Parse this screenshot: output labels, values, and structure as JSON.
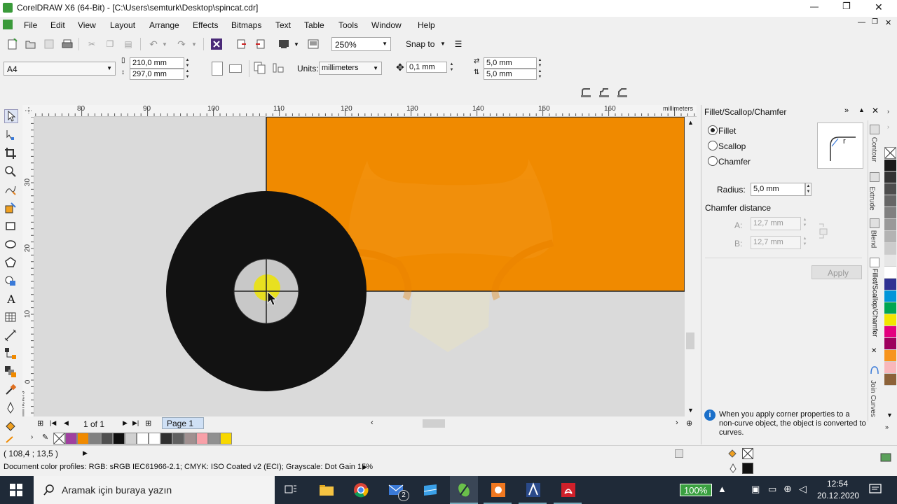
{
  "window": {
    "title": "CorelDRAW X6 (64-Bit) - [C:\\Users\\semturk\\Desktop\\spincat.cdr]",
    "controls": {
      "minimize": "—",
      "restore": "❐",
      "close": "✕"
    }
  },
  "menu": [
    "File",
    "Edit",
    "View",
    "Layout",
    "Arrange",
    "Effects",
    "Bitmaps",
    "Text",
    "Table",
    "Tools",
    "Window",
    "Help"
  ],
  "toolbar": {
    "zoom": "250%",
    "snap_to": "Snap to"
  },
  "propbar": {
    "page_size": "A4",
    "width": "210,0 mm",
    "height": "297,0 mm",
    "units_label": "Units:",
    "units_value": "millimeters",
    "nudge": "0,1 mm",
    "dup_x": "5,0 mm",
    "dup_y": "5,0 mm"
  },
  "ruler": {
    "h_ticks": [
      "80",
      "90",
      "100",
      "110",
      "120",
      "130",
      "140",
      "150",
      "160"
    ],
    "unit": "millimeters",
    "v_ticks": [
      "30",
      "20",
      "10",
      "0"
    ],
    "v_unit": "millimeters"
  },
  "page_nav": {
    "count": "1 of 1",
    "tab": "Page 1"
  },
  "docker": {
    "title": "Fillet/Scallop/Chamfer",
    "options": [
      "Fillet",
      "Scallop",
      "Chamfer"
    ],
    "selected": "Fillet",
    "radius_label": "Radius:",
    "radius_value": "5,0 mm",
    "chamfer_label": "Chamfer distance",
    "a_label": "A:",
    "a_value": "12,7 mm",
    "b_label": "B:",
    "b_value": "12,7 mm",
    "apply": "Apply",
    "info": "When you apply corner properties to a non-curve object, the object is converted to curves.",
    "preview_letter": "r",
    "tabs": [
      "Contour",
      "Extrude",
      "Blend",
      "Fillet/Scallop/Chamfer",
      "Join Curves"
    ]
  },
  "status": {
    "coords": "( 108,4 ; 13,5 )",
    "profiles": "Document color profiles: RGB: sRGB IEC61966-2.1; CMYK: ISO Coated v2 (ECI); Grayscale: Dot Gain 15%"
  },
  "taskbar": {
    "search": "Aramak için buraya yazın",
    "battery": "100%",
    "time": "12:54",
    "date": "20.12.2020",
    "mail_badge": "2"
  },
  "colors": {
    "orange": "#f08a00",
    "black": "#121212",
    "canvas": "#dadada",
    "yellow": "#e8e020",
    "taskbar": "#1f2a38"
  },
  "palette_bottom": [
    "#a040a0",
    "#f08a00",
    "#808080",
    "#505050",
    "#101010",
    "#d0d0d0",
    "#ffffff",
    "#ffffff",
    "#303030",
    "#606060",
    "#a09090",
    "#f8a0a8",
    "#909090",
    "#f8d800"
  ],
  "palette_right": [
    "#1a1a1a",
    "#333333",
    "#4d4d4d",
    "#666666",
    "#808080",
    "#999999",
    "#b3b3b3",
    "#cccccc",
    "#e6e6e6",
    "#ffffff",
    "#2e3192",
    "#0095d9",
    "#00a651",
    "#f2e500",
    "#e3007f",
    "#9e005d",
    "#f7941d",
    "#f9b7bb",
    "#8c6239"
  ]
}
